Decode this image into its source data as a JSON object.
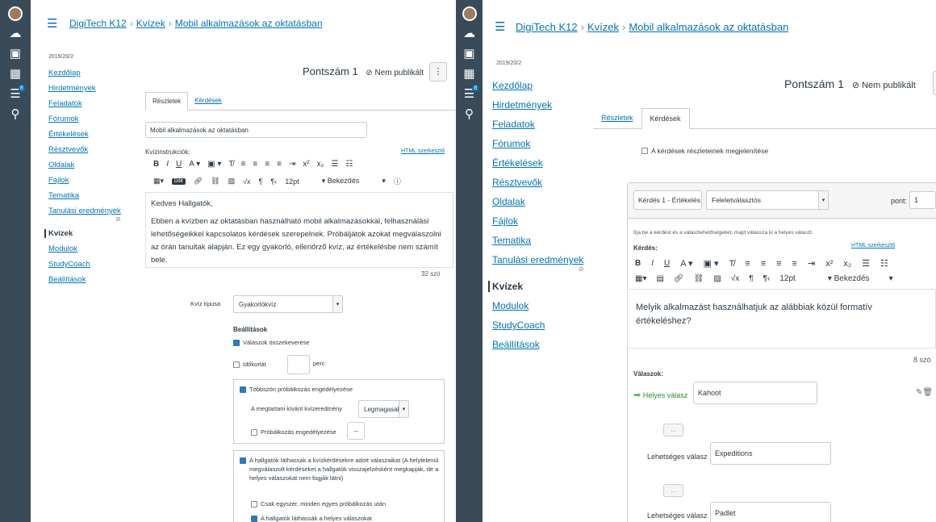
{
  "breadcrumb": {
    "course": "DigiTech K12",
    "section": "Kvízek",
    "page": "Mobil alkalmazások az oktatásban"
  },
  "term": "2019/20/2",
  "course_nav": [
    "Kezdőlap",
    "Hirdetmények",
    "Feladatok",
    "Fórumok",
    "Értékelések",
    "Résztvevők",
    "Oldalak",
    "Fájlok",
    "Tematika",
    "Tanulási eredmények",
    "Kvízek",
    "Modulok",
    "StudyCoach",
    "Beállítások"
  ],
  "nav_badge": "8",
  "header": {
    "points_label": "Pontszám",
    "points_value": "1",
    "publish_status": "Nem publikált",
    "more": "⋮"
  },
  "tabs": {
    "details": "Részletek",
    "questions": "Kérdések"
  },
  "left": {
    "title_value": "Mobil alkalmazások az oktatásban",
    "instructions_label": "Kvízinstrukciók:",
    "html_editor_link": "HTML szerkesztő",
    "toolbar_size": "12pt",
    "toolbar_format": "Bekezdés",
    "tooltip": "Dőlt",
    "editor_greeting": "Kedves Hallgatók,",
    "editor_body": "Ebben a kvízben az oktatásban használható mobil alkalmazásokkal, felhasználási lehetőségeikkel kapcsolatos kérdések szerepelnek. Próbáljátok azokat megválaszolni az órán tanultak alapján. Ez egy gyakorló, ellenőrző kvíz, az értékelésbe nem számít bele.",
    "word_count": "32 szó",
    "quiz_type_label": "Kvíz típusa",
    "quiz_type_value": "Gyakorlókvíz",
    "settings_heading": "Beállítások",
    "shuffle": "Válaszok összekeverése",
    "time_limit": "Időkorlát",
    "minutes": "perc",
    "multiple_attempts": "Többszöri próbálkozás engedélyezése",
    "keep_score_label": "A megtartani kívánt kvízeredmény",
    "keep_score_value": "Legmagasabb",
    "attempts_label": "Próbálkozás engedélyezése",
    "attempts_value": "--",
    "see_responses": "A hallgatók láthassák a kvízkérdésekre adott válaszaikat (A helytelenül megválaszolt kérdéseket a hallgatók visszajelzésként megkapják, de a helyes válaszokat nem fogják látni)",
    "once_after_attempt": "Csak egyszer, minden egyes próbálkozás után",
    "see_correct": "A hallgatók láthassák a helyes válaszokat"
  },
  "right": {
    "show_details": "A kérdések részleteinek megjelenítése",
    "question_name": "Kérdés 1 - Értékelés",
    "question_type": "Feleletválasztós",
    "pts_label": "pont:",
    "pts_value": "1",
    "instruction": "Írja be a kérdést és a válaszlehetőségeket, majd válassza ki a helyes választ.",
    "question_label": "Kérdés:",
    "html_editor_link": "HTML szerkesztő",
    "toolbar_size": "12pt",
    "toolbar_format": "Bekezdés",
    "question_text": "Melyik alkalmazást használhatjuk az alábbiak közül formatív értékeléshez?",
    "word_count": "8 szó",
    "answers_label": "Válaszok:",
    "correct_label": "Helyes válasz",
    "possible_label": "Lehetséges válasz",
    "answers": [
      "Kahoot",
      "Expeditions",
      "Padlet"
    ],
    "ans_btn": "..."
  }
}
